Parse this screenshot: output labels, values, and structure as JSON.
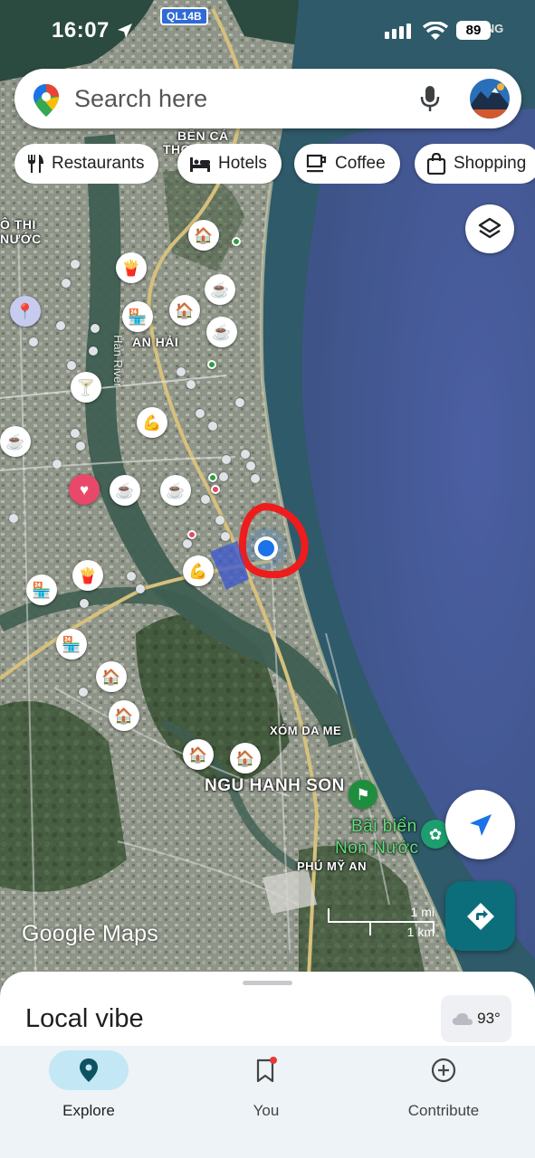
{
  "status_bar": {
    "time": "16:07",
    "battery": "89",
    "top_right_area": "NANG"
  },
  "map": {
    "road_shield": "QL14B",
    "labels": {
      "ben_ca": "BẾN CÁ",
      "tho": "THO",
      "do_thi": "Ô THỊ",
      "nuoc": "NƯỚC",
      "an_hai": "AN HẢI",
      "han_river": "Hàn River",
      "xom_da_me": "XÓM DA ME",
      "ngu_hanh_son": "NGU HANH SON",
      "bai_bien_1": "Bãi biển",
      "bai_bien_2": "Non Nước",
      "phu_my_an": "PHÚ MỸ AN"
    },
    "watermark": "Google Maps",
    "scale": {
      "mi": "1 mi",
      "km": "1 km"
    },
    "poi_icons": [
      "hotel",
      "fries",
      "coffee",
      "convenience-store",
      "cocktail",
      "gym",
      "heart",
      "pin-location",
      "park"
    ]
  },
  "search": {
    "placeholder": "Search here"
  },
  "chips": [
    {
      "label": "Restaurants",
      "icon": "fork-knife-icon"
    },
    {
      "label": "Hotels",
      "icon": "bed-icon"
    },
    {
      "label": "Coffee",
      "icon": "coffee-icon"
    },
    {
      "label": "Shopping",
      "icon": "shopping-bag-icon"
    }
  ],
  "bottom_sheet": {
    "title": "Local vibe",
    "weather": "93°"
  },
  "nav": {
    "explore": "Explore",
    "you": "You",
    "contribute": "Contribute"
  },
  "colors": {
    "ocean": "#4a5f9e",
    "accent": "#1a73e8",
    "nav_active": "#c3e7f5",
    "directions": "#0b6e7a"
  }
}
